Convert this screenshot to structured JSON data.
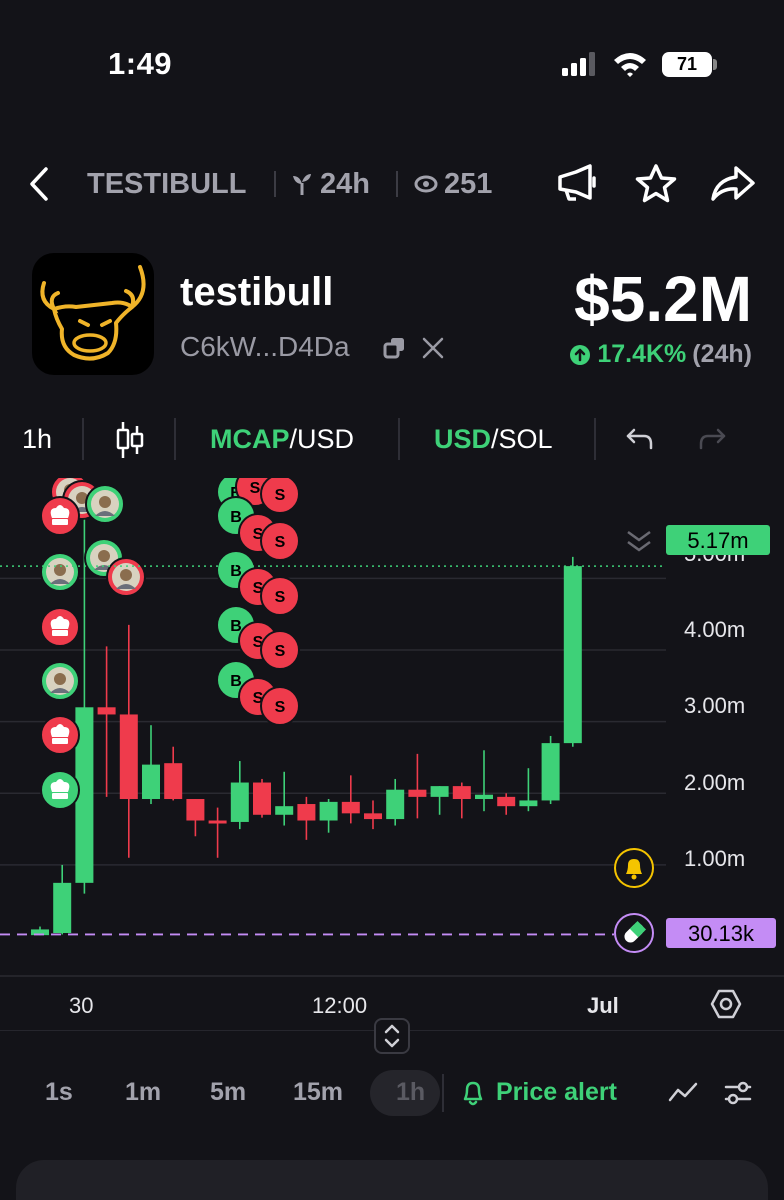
{
  "status_bar": {
    "time": "1:49",
    "battery": "71"
  },
  "header": {
    "ticker": "TESTIBULL",
    "age": "24h",
    "viewers": "251"
  },
  "token": {
    "name": "testibull",
    "address": "C6kW...D4Da",
    "market_cap": "$5.2M",
    "change": "17.4K%",
    "change_period": "(24h)"
  },
  "toolbar": {
    "interval": "1h",
    "mcap_primary": "MCAP",
    "mcap_secondary": "/USD",
    "currency_primary": "USD",
    "currency_secondary": "/SOL"
  },
  "colors": {
    "up": "#3ed178",
    "down": "#ef3b4c",
    "accent_purple": "#c48cf5",
    "bell": "#f5c400"
  },
  "chart_data": {
    "type": "candlestick",
    "y_ticks": [
      "1.00m",
      "2.00m",
      "3.00m",
      "4.00m",
      "5.00m"
    ],
    "y_tick_values": [
      1.0,
      2.0,
      3.0,
      4.0,
      5.0
    ],
    "x_ticks": [
      "30",
      "12:00",
      "Jul"
    ],
    "current_value": "5.17m",
    "current_value_num": 5.17,
    "marker_value": "30.13k",
    "marker_value_num": 0.0301,
    "ylim": [
      -0.55,
      6.4
    ],
    "candles": [
      {
        "o": 0.02,
        "h": 0.14,
        "l": 0.02,
        "c": 0.1
      },
      {
        "o": 0.05,
        "h": 1.0,
        "l": 0.03,
        "c": 0.75
      },
      {
        "o": 0.75,
        "h": 6.2,
        "l": 0.6,
        "c": 3.2
      },
      {
        "o": 3.2,
        "h": 4.05,
        "l": 1.95,
        "c": 3.1
      },
      {
        "o": 3.1,
        "h": 4.35,
        "l": 1.1,
        "c": 1.92
      },
      {
        "o": 1.92,
        "h": 2.95,
        "l": 1.85,
        "c": 2.4
      },
      {
        "o": 2.42,
        "h": 2.65,
        "l": 1.9,
        "c": 1.92
      },
      {
        "o": 1.92,
        "h": 1.92,
        "l": 1.4,
        "c": 1.62
      },
      {
        "o": 1.62,
        "h": 1.8,
        "l": 1.1,
        "c": 1.58
      },
      {
        "o": 1.6,
        "h": 2.45,
        "l": 1.5,
        "c": 2.15
      },
      {
        "o": 2.15,
        "h": 2.2,
        "l": 1.66,
        "c": 1.7
      },
      {
        "o": 1.7,
        "h": 2.3,
        "l": 1.55,
        "c": 1.82
      },
      {
        "o": 1.85,
        "h": 1.95,
        "l": 1.35,
        "c": 1.62
      },
      {
        "o": 1.62,
        "h": 1.92,
        "l": 1.45,
        "c": 1.88
      },
      {
        "o": 1.88,
        "h": 2.25,
        "l": 1.58,
        "c": 1.72
      },
      {
        "o": 1.72,
        "h": 1.9,
        "l": 1.5,
        "c": 1.64
      },
      {
        "o": 1.64,
        "h": 2.2,
        "l": 1.55,
        "c": 2.05
      },
      {
        "o": 2.05,
        "h": 2.55,
        "l": 1.65,
        "c": 1.95
      },
      {
        "o": 1.95,
        "h": 2.1,
        "l": 1.7,
        "c": 2.1
      },
      {
        "o": 2.1,
        "h": 2.15,
        "l": 1.65,
        "c": 1.92
      },
      {
        "o": 1.92,
        "h": 2.6,
        "l": 1.75,
        "c": 1.98
      },
      {
        "o": 1.95,
        "h": 2.0,
        "l": 1.7,
        "c": 1.82
      },
      {
        "o": 1.82,
        "h": 2.35,
        "l": 1.75,
        "c": 1.9
      },
      {
        "o": 1.9,
        "h": 2.8,
        "l": 1.85,
        "c": 2.7
      },
      {
        "o": 2.7,
        "h": 5.3,
        "l": 2.65,
        "c": 5.17
      }
    ],
    "trade_markers": [
      {
        "x": 70,
        "y": 492,
        "type": "avatar",
        "color": "#ef3b4c"
      },
      {
        "x": 82,
        "y": 500,
        "type": "avatar",
        "color": "#ef3b4c"
      },
      {
        "x": 105,
        "y": 504,
        "type": "avatar",
        "color": "#3ed178"
      },
      {
        "x": 60,
        "y": 516,
        "type": "chef",
        "color": "#ef3b4c"
      },
      {
        "x": 104,
        "y": 558,
        "type": "avatar",
        "color": "#3ed178"
      },
      {
        "x": 60,
        "y": 572,
        "type": "avatar",
        "color": "#3ed178"
      },
      {
        "x": 126,
        "y": 577,
        "type": "avatar",
        "color": "#ef3b4c"
      },
      {
        "x": 60,
        "y": 627,
        "type": "chef",
        "color": "#ef3b4c"
      },
      {
        "x": 60,
        "y": 681,
        "type": "avatar",
        "color": "#3ed178"
      },
      {
        "x": 60,
        "y": 735,
        "type": "chef",
        "color": "#ef3b4c"
      },
      {
        "x": 60,
        "y": 790,
        "type": "chef",
        "color": "#3ed178"
      }
    ],
    "bs_markers": [
      {
        "x": 236,
        "y": 492,
        "label": "B",
        "color": "#3ed178"
      },
      {
        "x": 255,
        "y": 487,
        "label": "S",
        "color": "#ef3b4c"
      },
      {
        "x": 280,
        "y": 494,
        "label": "S",
        "color": "#ef3b4c"
      },
      {
        "x": 236,
        "y": 516,
        "label": "B",
        "color": "#3ed178"
      },
      {
        "x": 258,
        "y": 533,
        "label": "S",
        "color": "#ef3b4c"
      },
      {
        "x": 280,
        "y": 541,
        "label": "S",
        "color": "#ef3b4c"
      },
      {
        "x": 236,
        "y": 570,
        "label": "B",
        "color": "#3ed178"
      },
      {
        "x": 258,
        "y": 587,
        "label": "S",
        "color": "#ef3b4c"
      },
      {
        "x": 280,
        "y": 596,
        "label": "S",
        "color": "#ef3b4c"
      },
      {
        "x": 236,
        "y": 625,
        "label": "B",
        "color": "#3ed178"
      },
      {
        "x": 258,
        "y": 641,
        "label": "S",
        "color": "#ef3b4c"
      },
      {
        "x": 280,
        "y": 650,
        "label": "S",
        "color": "#ef3b4c"
      },
      {
        "x": 236,
        "y": 680,
        "label": "B",
        "color": "#3ed178"
      },
      {
        "x": 258,
        "y": 697,
        "label": "S",
        "color": "#ef3b4c"
      },
      {
        "x": 280,
        "y": 706,
        "label": "S",
        "color": "#ef3b4c"
      }
    ]
  },
  "timeframes": [
    "1s",
    "1m",
    "5m",
    "15m",
    "1h"
  ],
  "active_timeframe": "1h",
  "price_alert_label": "Price alert"
}
